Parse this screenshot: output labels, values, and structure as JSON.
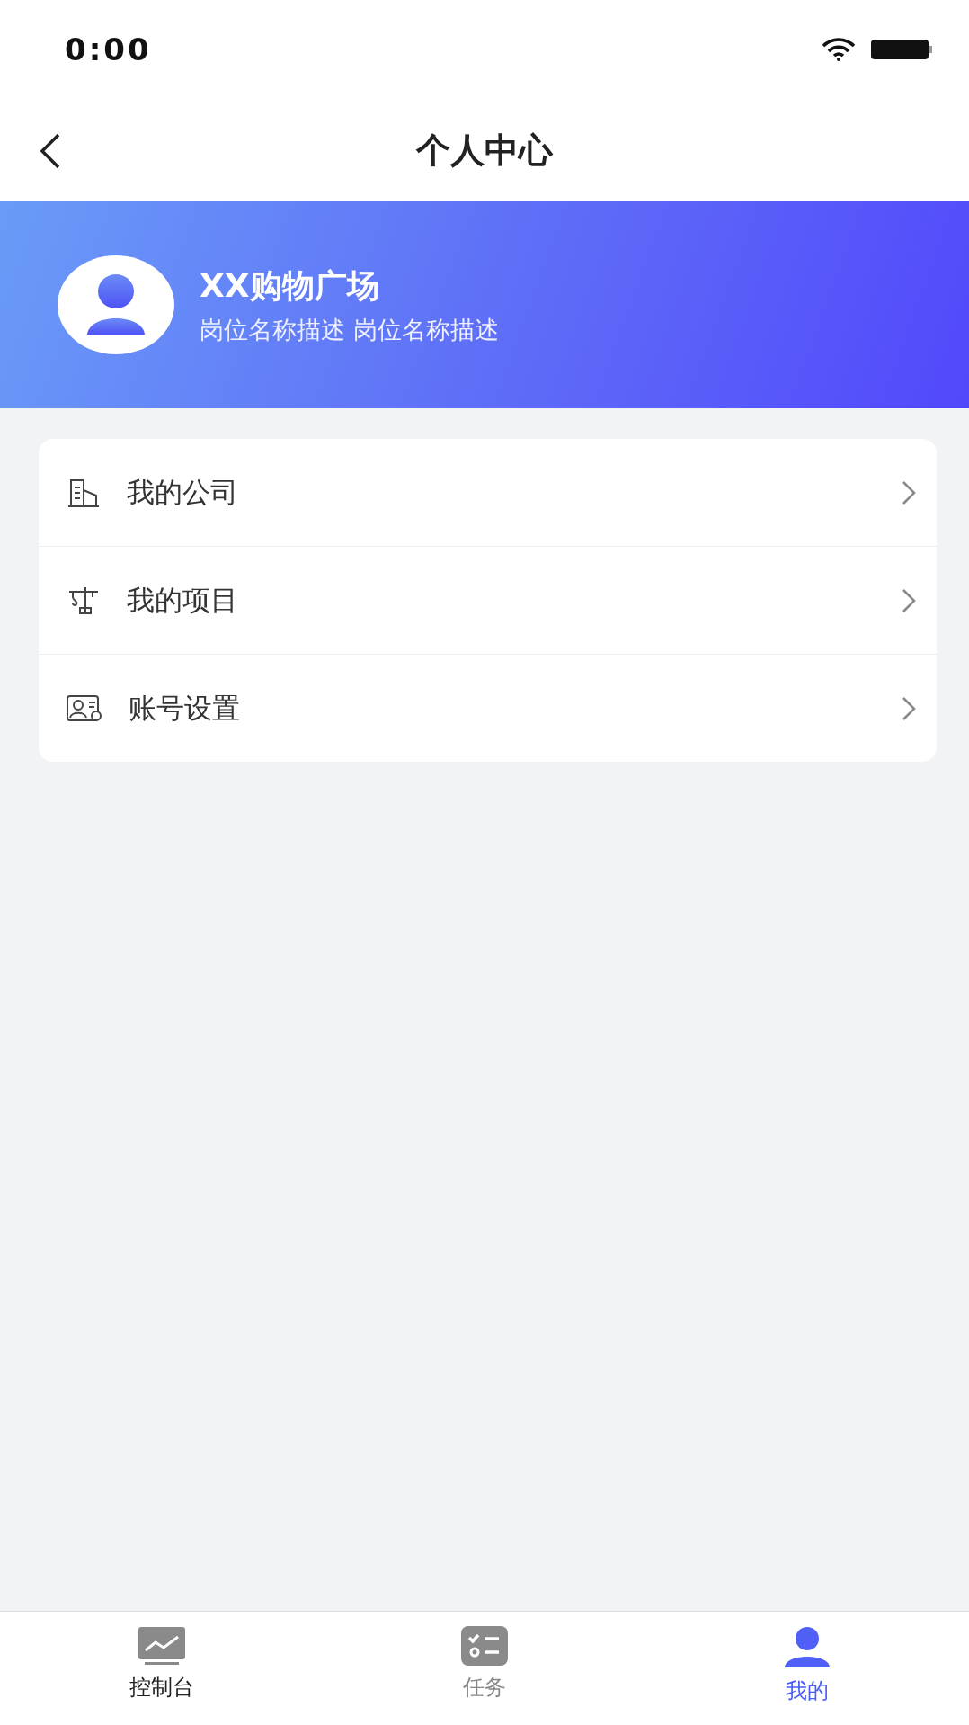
{
  "status_bar": {
    "time": "0:00"
  },
  "nav": {
    "title": "个人中心"
  },
  "profile": {
    "name": "XX购物广场",
    "position": "岗位名称描述 岗位名称描述"
  },
  "menu": [
    {
      "kind": "company",
      "label": "我的公司"
    },
    {
      "kind": "project",
      "label": "我的项目"
    },
    {
      "kind": "account",
      "label": "账号设置"
    }
  ],
  "tabs": [
    {
      "kind": "dashboard",
      "label": "控制台",
      "selected": false
    },
    {
      "kind": "tasks",
      "label": "任务",
      "selected": false
    },
    {
      "kind": "me",
      "label": "我的",
      "selected": true
    }
  ]
}
